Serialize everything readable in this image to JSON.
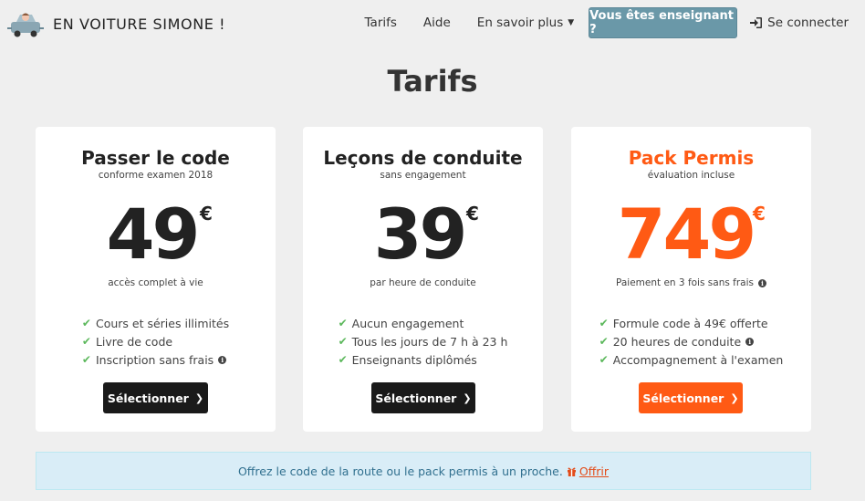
{
  "brand": {
    "name": "EN VOITURE SIMONE !"
  },
  "nav": {
    "tarifs": "Tarifs",
    "aide": "Aide",
    "savoir_plus": "En savoir plus",
    "teacher": "Vous êtes enseignant ?",
    "login": "Se connecter"
  },
  "page": {
    "title": "Tarifs"
  },
  "cards": [
    {
      "title": "Passer le code",
      "subtitle": "conforme examen 2018",
      "price": "49",
      "currency": "€",
      "price_note": "accès complet à vie",
      "features": [
        "Cours et séries illimités",
        "Livre de code",
        "Inscription sans frais"
      ],
      "button": "Sélectionner",
      "accent": "#1a1a1a"
    },
    {
      "title": "Leçons de conduite",
      "subtitle": "sans engagement",
      "price": "39",
      "currency": "€",
      "price_note": "par heure de conduite",
      "features": [
        "Aucun engagement",
        "Tous les jours de 7 h à 23 h",
        "Enseignants diplômés"
      ],
      "button": "Sélectionner",
      "accent": "#1a1a1a"
    },
    {
      "title": "Pack Permis",
      "subtitle": "évaluation incluse",
      "price": "749",
      "currency": "€",
      "price_note": "Paiement en 3 fois sans frais",
      "features": [
        "Formule code à 49€ offerte",
        "20 heures de conduite",
        "Accompagnement à l'examen"
      ],
      "button": "Sélectionner",
      "accent": "#ff5a14"
    }
  ],
  "offer": {
    "text": "Offrez le code de la route ou le pack permis à un proche.",
    "link": "Offrir"
  },
  "colors": {
    "background": "#efefef",
    "teacher_button": "#6a98a8",
    "orange": "#ff5a14",
    "check": "#5cb85c",
    "offer_bg": "#d9edf7"
  }
}
